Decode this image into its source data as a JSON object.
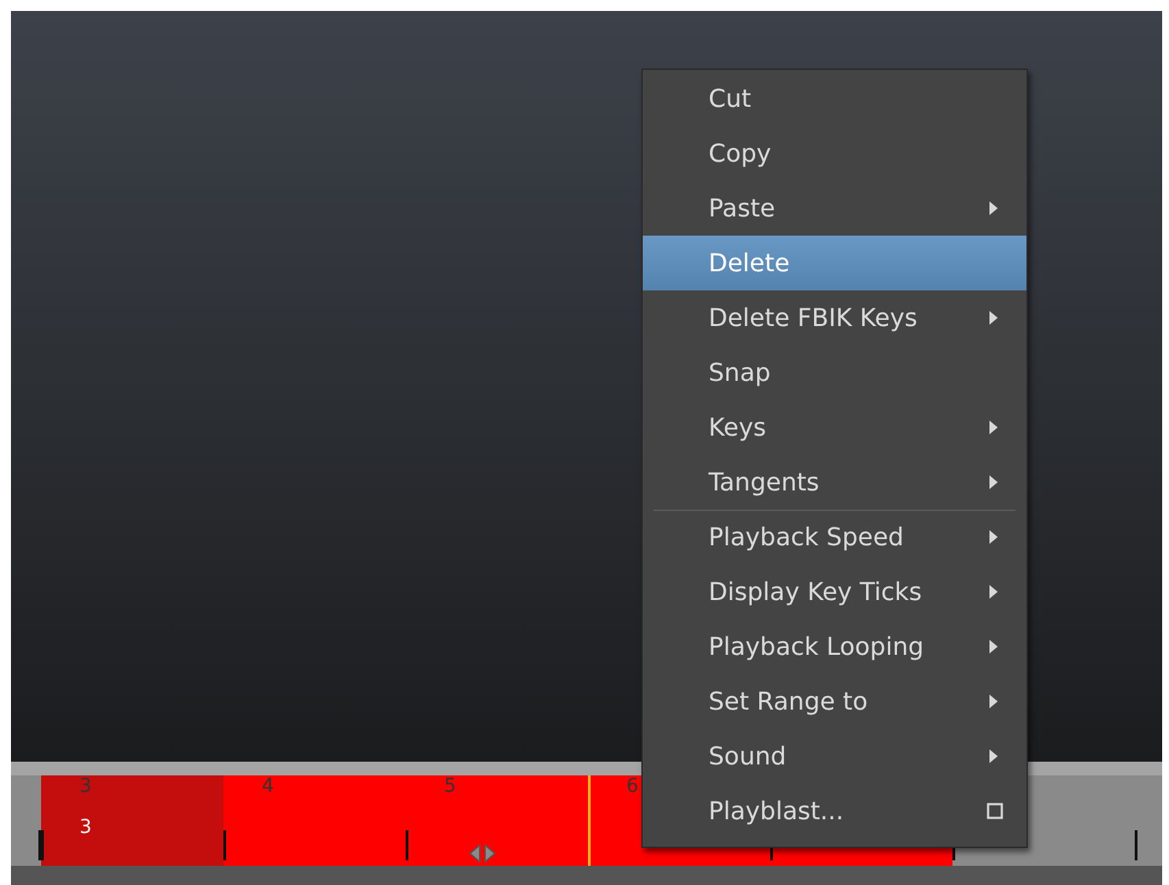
{
  "timeline": {
    "current_frame": "3",
    "segments": [
      {
        "label": "3",
        "kind": "current",
        "cursor": false
      },
      {
        "label": "4",
        "kind": "range",
        "cursor": false
      },
      {
        "label": "5",
        "kind": "range",
        "cursor": false
      },
      {
        "label": "6",
        "kind": "range",
        "cursor": true
      },
      {
        "kind": "range",
        "cursor": false
      },
      {
        "kind": "outside",
        "cursor": false
      }
    ]
  },
  "context_menu": {
    "items": [
      {
        "label": "Cut",
        "kind": "action",
        "selected": false,
        "separator_before": false
      },
      {
        "label": "Copy",
        "kind": "action",
        "selected": false,
        "separator_before": false
      },
      {
        "label": "Paste",
        "kind": "submenu",
        "selected": false,
        "separator_before": false
      },
      {
        "label": "Delete",
        "kind": "action",
        "selected": true,
        "separator_before": false
      },
      {
        "label": "Delete FBIK Keys",
        "kind": "submenu",
        "selected": false,
        "separator_before": false
      },
      {
        "label": "Snap",
        "kind": "action",
        "selected": false,
        "separator_before": false
      },
      {
        "label": "Keys",
        "kind": "submenu",
        "selected": false,
        "separator_before": false
      },
      {
        "label": "Tangents",
        "kind": "submenu",
        "selected": false,
        "separator_before": false
      },
      {
        "label": "Playback Speed",
        "kind": "submenu",
        "selected": false,
        "separator_before": true
      },
      {
        "label": "Display Key Ticks",
        "kind": "submenu",
        "selected": false,
        "separator_before": false
      },
      {
        "label": "Playback Looping",
        "kind": "submenu",
        "selected": false,
        "separator_before": false
      },
      {
        "label": "Set Range to",
        "kind": "submenu",
        "selected": false,
        "separator_before": false
      },
      {
        "label": "Sound",
        "kind": "submenu",
        "selected": false,
        "separator_before": false
      },
      {
        "label": "Playblast...",
        "kind": "option",
        "selected": false,
        "separator_before": false
      }
    ]
  }
}
